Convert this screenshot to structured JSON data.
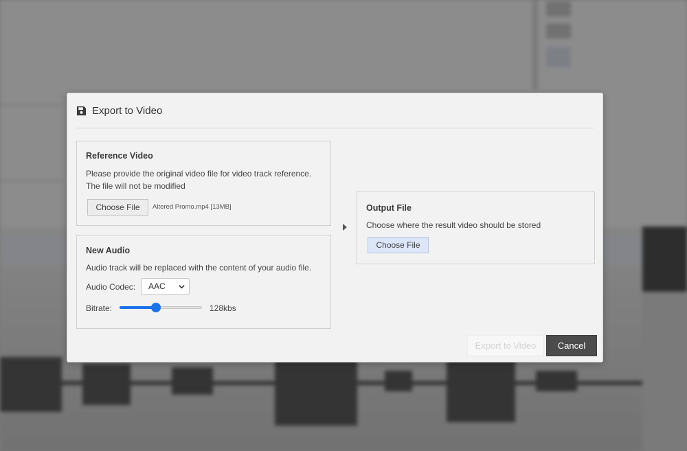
{
  "dialog": {
    "title": "Export to Video",
    "icon": "floppy-disk-icon"
  },
  "reference_video": {
    "title": "Reference Video",
    "line1": "Please provide the original video file for video track reference.",
    "line2": "The file will not be modified",
    "choose_label": "Choose File",
    "file_name": "Altered Promo.mp4 [13MB]"
  },
  "new_audio": {
    "title": "New Audio",
    "description": "Audio track will be replaced with the content of your audio file.",
    "codec_label": "Audio Codec:",
    "codec_value": "AAC",
    "bitrate_label": "Bitrate:",
    "bitrate_value": "128kbs",
    "bitrate_fraction": 0.43
  },
  "output_file": {
    "title": "Output File",
    "description": "Choose where the result video should be stored",
    "choose_label": "Choose File"
  },
  "footer": {
    "export_label": "Export to Video",
    "cancel_label": "Cancel"
  },
  "colors": {
    "accent": "#1a73e8",
    "cancel_bg": "#4c4c4c"
  }
}
